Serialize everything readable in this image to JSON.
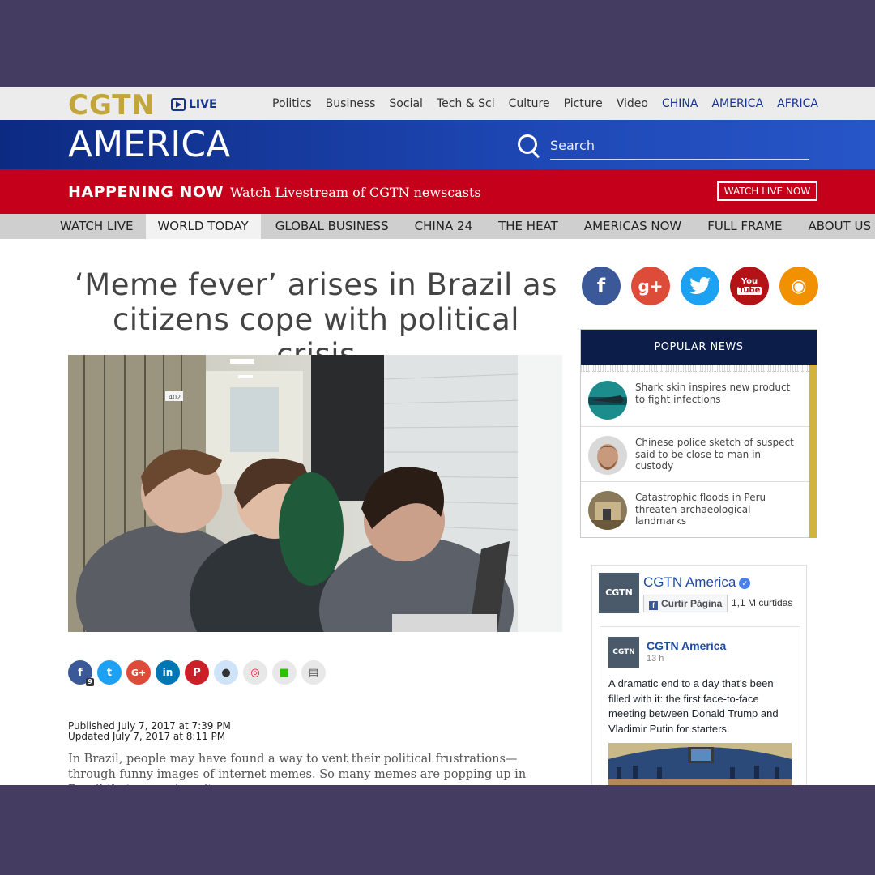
{
  "header": {
    "logo": "CGTN",
    "live": "LIVE",
    "nav": [
      "Politics",
      "Business",
      "Social",
      "Tech & Sci",
      "Culture",
      "Picture",
      "Video"
    ],
    "regions": [
      "CHINA",
      "AMERICA",
      "AFRICA"
    ]
  },
  "banner": {
    "title": "AMERICA",
    "search_placeholder": "Search"
  },
  "happening": {
    "label": "HAPPENING NOW",
    "text": "Watch Livestream of CGTN newscasts",
    "button": "WATCH LIVE NOW"
  },
  "sections": [
    {
      "label": "WATCH LIVE",
      "active": false
    },
    {
      "label": "WORLD TODAY",
      "active": true
    },
    {
      "label": "GLOBAL BUSINESS",
      "active": false
    },
    {
      "label": "CHINA 24",
      "active": false
    },
    {
      "label": "THE HEAT",
      "active": false
    },
    {
      "label": "AMERICAS NOW",
      "active": false
    },
    {
      "label": "FULL FRAME",
      "active": false
    },
    {
      "label": "ABOUT US",
      "active": false
    }
  ],
  "article": {
    "headline": "‘Meme fever’ arises in Brazil as citizens cope with political crisis",
    "share_count": "9",
    "published": "Published July 7, 2017 at 7:39 PM",
    "updated": "Updated July 7, 2017 at 8:11 PM",
    "body": "In Brazil, people may have found a way to vent their political frustrations—through funny images of internet memes. So many memes are popping up in Brazil that one university"
  },
  "social": {
    "facebook": "f",
    "googleplus": "g+",
    "youtube_top": "You",
    "youtube_bottom": "Tube"
  },
  "popular": {
    "title": "POPULAR NEWS",
    "items": [
      {
        "text": "Shark skin inspires new product to fight infections"
      },
      {
        "text": "Chinese police sketch of suspect said to be close to man in custody"
      },
      {
        "text": "Catastrophic floods in Peru threaten archaeological landmarks"
      }
    ]
  },
  "facebook": {
    "page_name": "CGTN America",
    "like_button": "Curtir Página",
    "likes": "1,1 M curtidas",
    "logo_text": "CGTN",
    "post": {
      "author": "CGTN America",
      "time": "13 h",
      "message": "A dramatic end to a day that’s been filled with it: the first face-to-face meeting between Donald Trump and Vladimir Putin for starters."
    }
  },
  "colors": {
    "gold": "#c2a53b",
    "navy": "#15358f",
    "red": "#c4001a",
    "popular_header": "#0d1d4a"
  }
}
